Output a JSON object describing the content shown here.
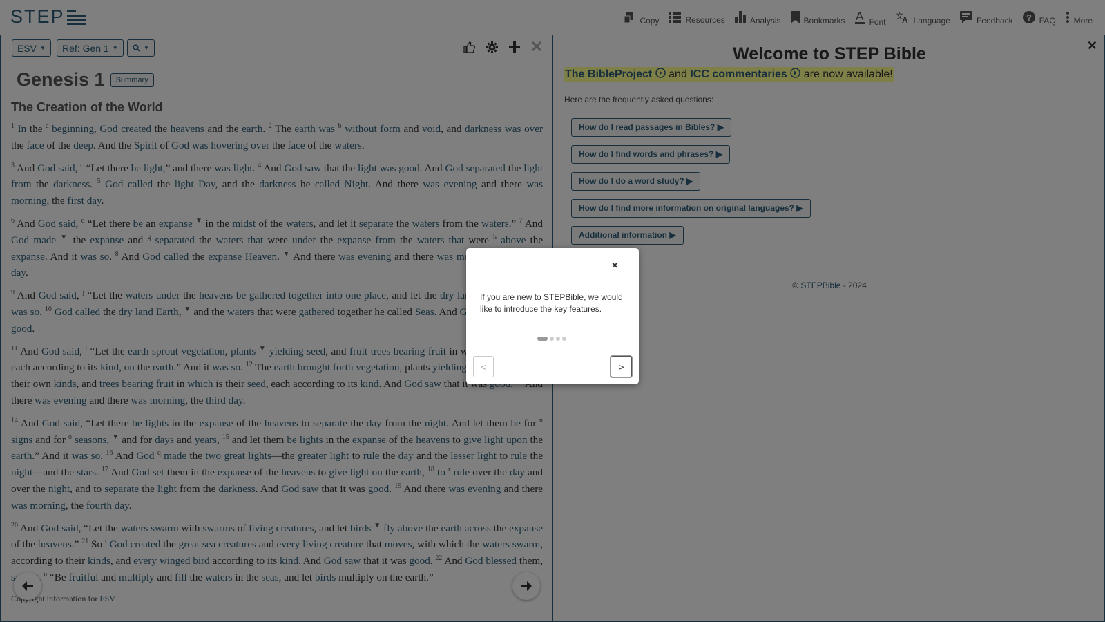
{
  "app": {
    "logo_text": "STEP"
  },
  "menu": {
    "items": [
      {
        "label": "Copy",
        "icon": "copy-icon"
      },
      {
        "label": "Resources",
        "icon": "list-icon"
      },
      {
        "label": "Analysis",
        "icon": "bar-chart-icon"
      },
      {
        "label": "Bookmarks",
        "icon": "bookmark-icon"
      },
      {
        "label": "Font",
        "icon": "font-icon"
      },
      {
        "label": "Language",
        "icon": "translate-icon"
      },
      {
        "label": "Feedback",
        "icon": "comment-icon"
      },
      {
        "label": "FAQ",
        "icon": "question-icon"
      },
      {
        "label": "More",
        "icon": "more-vertical-icon"
      }
    ]
  },
  "left_panel": {
    "toolbar": {
      "version": "ESV",
      "reference": "Ref: Gen 1",
      "search_icon": "🔍"
    },
    "chapter_title": "Genesis 1",
    "summary_label": "Summary",
    "section_title": "The Creation of the World",
    "copyright": "Copyright information for",
    "copyright_link": "ESV"
  },
  "right_panel": {
    "welcome_title": "Welcome to STEP Bible",
    "announce": {
      "part1": "The BibleProject",
      "part2": "and",
      "part3": "ICC commentaries",
      "part4": "are now available!"
    },
    "faq_intro": "Here are the frequently asked questions:",
    "faq_buttons": [
      "How do I read passages in Bibles?",
      "How do I find words and phrases?",
      "How do I do a word study?",
      "How do I find more information on original languages?",
      "Additional information"
    ],
    "footer": {
      "prefix": "©",
      "link": "STEPBible",
      "suffix": "- 2024"
    }
  },
  "modal": {
    "close": "×",
    "text": "If you are new to STEPBible, we would like to introduce the key features.",
    "prev": "<",
    "next": ">",
    "steps_total": 4,
    "step_current": 1
  },
  "colors": {
    "accent": "#2e5f79",
    "highlight": "#ffff91"
  }
}
